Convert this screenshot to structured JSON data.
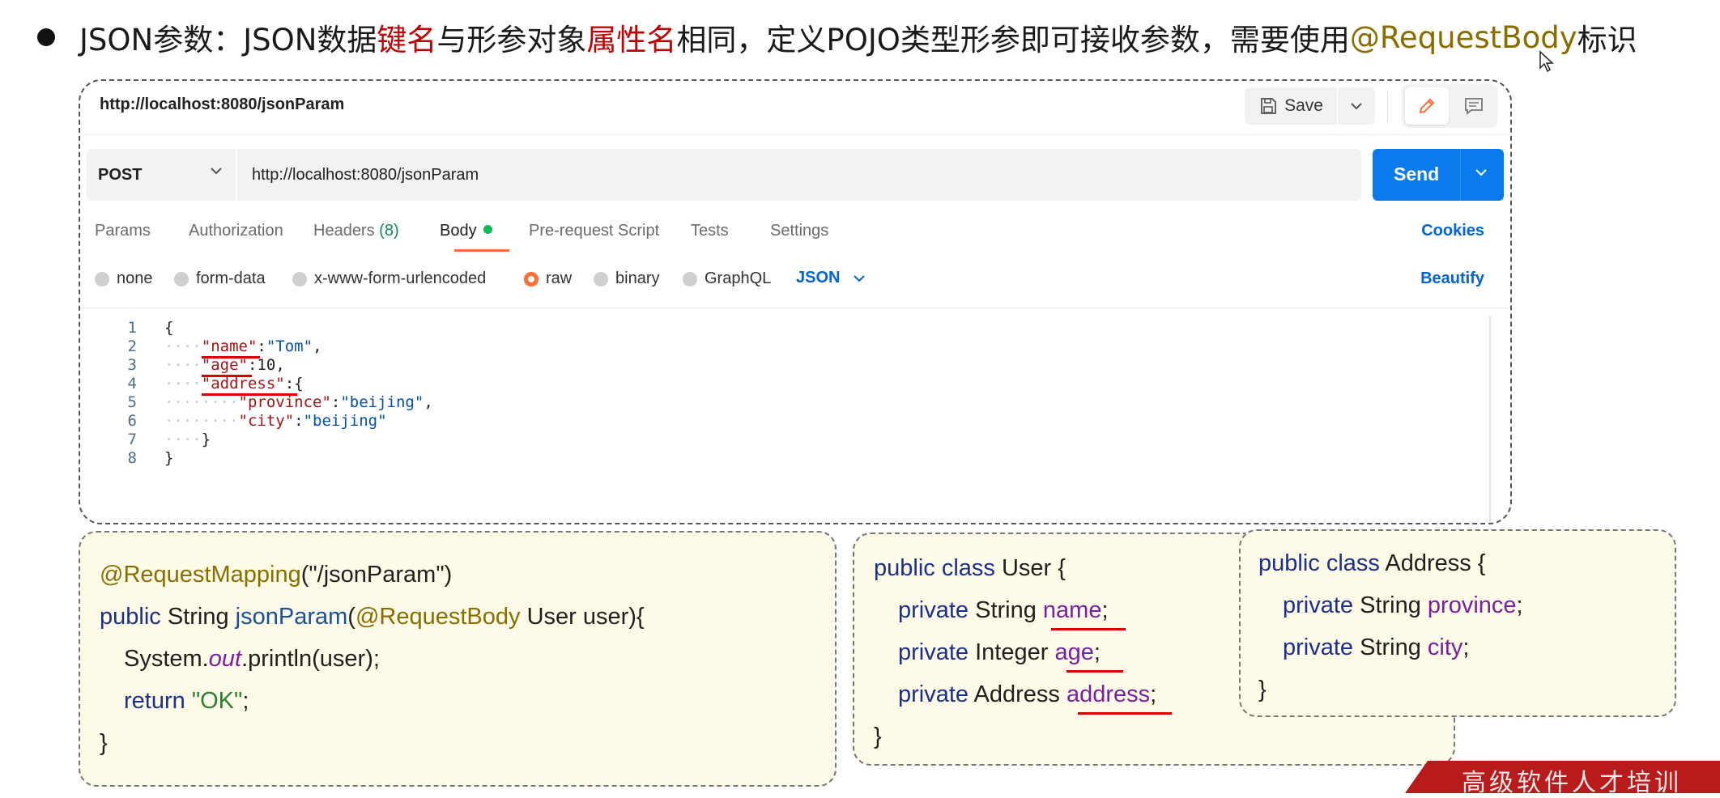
{
  "heading": {
    "part1": "JSON参数：JSON数据",
    "part2": "键名",
    "part3": "与形参对象",
    "part4": "属性名",
    "part5": "相同，定义POJO类型形参即可接收参数，需要使用 ",
    "part6": "@RequestBody",
    "part7": " 标识"
  },
  "postman": {
    "title": "http://localhost:8080/jsonParam",
    "save_label": "Save",
    "method": "POST",
    "url": "http://localhost:8080/jsonParam",
    "send_label": "Send",
    "tabs": {
      "params": "Params",
      "authorization": "Authorization",
      "headers": "Headers",
      "headers_count": "(8)",
      "body": "Body",
      "prerequest": "Pre-request Script",
      "tests": "Tests",
      "settings": "Settings"
    },
    "cookies": "Cookies",
    "body_types": {
      "none": "none",
      "form_data": "form-data",
      "urlencoded": "x-www-form-urlencoded",
      "raw": "raw",
      "binary": "binary",
      "graphql": "GraphQL"
    },
    "selected_body_type": "raw",
    "format": "JSON",
    "beautify": "Beautify",
    "line_numbers": [
      "1",
      "2",
      "3",
      "4",
      "5",
      "6",
      "7",
      "8"
    ],
    "code": {
      "l1": "{",
      "k_name": "\"name\"",
      "v_name": "\"Tom\"",
      "k_age": "\"age\"",
      "v_age": "10",
      "k_address": "\"address\"",
      "k_province": "\"province\"",
      "v_province": "\"beijing\"",
      "k_city": "\"city\"",
      "v_city": "\"beijing\"",
      "l7": "}",
      "l8": "}"
    }
  },
  "controller": {
    "annotation": "@RequestMapping",
    "mapping_arg": "(\"/jsonParam\")",
    "kw_public": "public",
    "ret_type": " String ",
    "method": "jsonParam",
    "paren_open": "(",
    "body_ann": "@RequestBody",
    "param": " User user){",
    "println_a": "System.",
    "println_out": "out",
    "println_b": ".println(user);",
    "kw_return": "return",
    "ret_val": "\"OK\"",
    "semi": ";",
    "close": "}"
  },
  "user_class": {
    "kw": "public class",
    "name": " User {",
    "kw_private": "private",
    "t_string": " String ",
    "f_name": "name",
    "t_integer": " Integer ",
    "f_age": "age",
    "t_address": " Address ",
    "f_address": "address",
    "semi": ";",
    "close": "}"
  },
  "address_class": {
    "kw": "public class",
    "name": " Address {",
    "kw_private": "private",
    "t_string": " String ",
    "f_province": "province",
    "f_city": "city",
    "semi": ";",
    "close": "}"
  },
  "footer_text": "高级软件人才培训",
  "colors": {
    "accent_red": "#c00000",
    "annotation_gold": "#8a6d00",
    "postman_blue": "#097bed",
    "postman_orange": "#ff6c37",
    "box_bg": "#fefce9"
  }
}
